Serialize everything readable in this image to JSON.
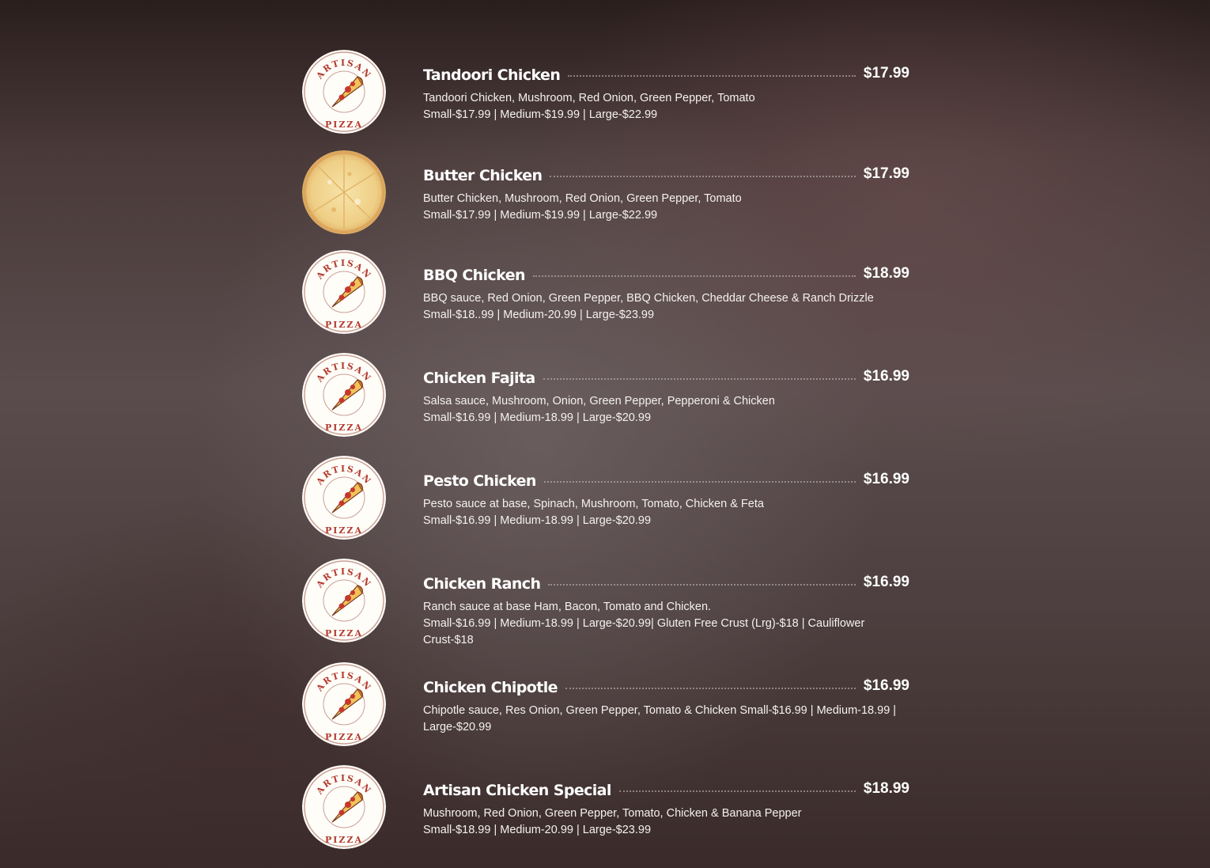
{
  "items": [
    {
      "name": "Tandoori Chicken",
      "price": "$17.99",
      "ingredients": "Tandoori Chicken, Mushroom, Red Onion, Green Pepper, Tomato",
      "sizes": "Small-$17.99 | Medium-$19.99 | Large-$22.99",
      "image": "artisan-pizza-logo"
    },
    {
      "name": "Butter Chicken",
      "price": "$17.99",
      "ingredients": "Butter Chicken, Mushroom, Red Onion, Green Pepper, Tomato",
      "sizes": "Small-$17.99 | Medium-$19.99 | Large-$22.99",
      "image": "cheese-pizza-photo"
    },
    {
      "name": "BBQ Chicken",
      "price": "$18.99",
      "ingredients": "BBQ sauce, Red Onion, Green Pepper, BBQ Chicken, Cheddar Cheese & Ranch Drizzle",
      "sizes": "Small-$18..99 | Medium-20.99 | Large-$23.99",
      "image": "artisan-pizza-logo"
    },
    {
      "name": "Chicken Fajita",
      "price": "$16.99",
      "ingredients": "Salsa sauce, Mushroom, Onion, Green Pepper, Pepperoni & Chicken",
      "sizes": "Small-$16.99 | Medium-18.99 | Large-$20.99",
      "image": "artisan-pizza-logo"
    },
    {
      "name": "Pesto Chicken",
      "price": "$16.99",
      "ingredients": "Pesto sauce at base, Spinach, Mushroom, Tomato, Chicken & Feta",
      "sizes": "Small-$16.99 | Medium-18.99 | Large-$20.99",
      "image": "artisan-pizza-logo"
    },
    {
      "name": "Chicken Ranch",
      "price": "$16.99",
      "ingredients": "Ranch sauce at base Ham, Bacon, Tomato and Chicken.",
      "sizes": "Small-$16.99 | Medium-18.99 | Large-$20.99| Gluten Free Crust (Lrg)-$18 | Cauliflower Crust-$18",
      "image": "artisan-pizza-logo"
    },
    {
      "name": "Chicken Chipotle",
      "price": "$16.99",
      "ingredients": "Chipotle sauce, Res Onion, Green Pepper, Tomato & Chicken Small-$16.99 | Medium-18.99 | Large-$20.99",
      "sizes": "",
      "image": "artisan-pizza-logo"
    },
    {
      "name": "Artisan Chicken Special",
      "price": "$18.99",
      "ingredients": "Mushroom, Red Onion, Green Pepper, Tomato, Chicken & Banana Pepper",
      "sizes": "Small-$18.99 | Medium-20.99 | Large-$23.99",
      "image": "artisan-pizza-logo"
    }
  ],
  "logo": {
    "top_text": "ARTISAN",
    "bottom_text": "PIZZA"
  },
  "colors": {
    "logo_red": "#b33a2e",
    "logo_ring": "#c9a097",
    "text": "#ffffff"
  }
}
